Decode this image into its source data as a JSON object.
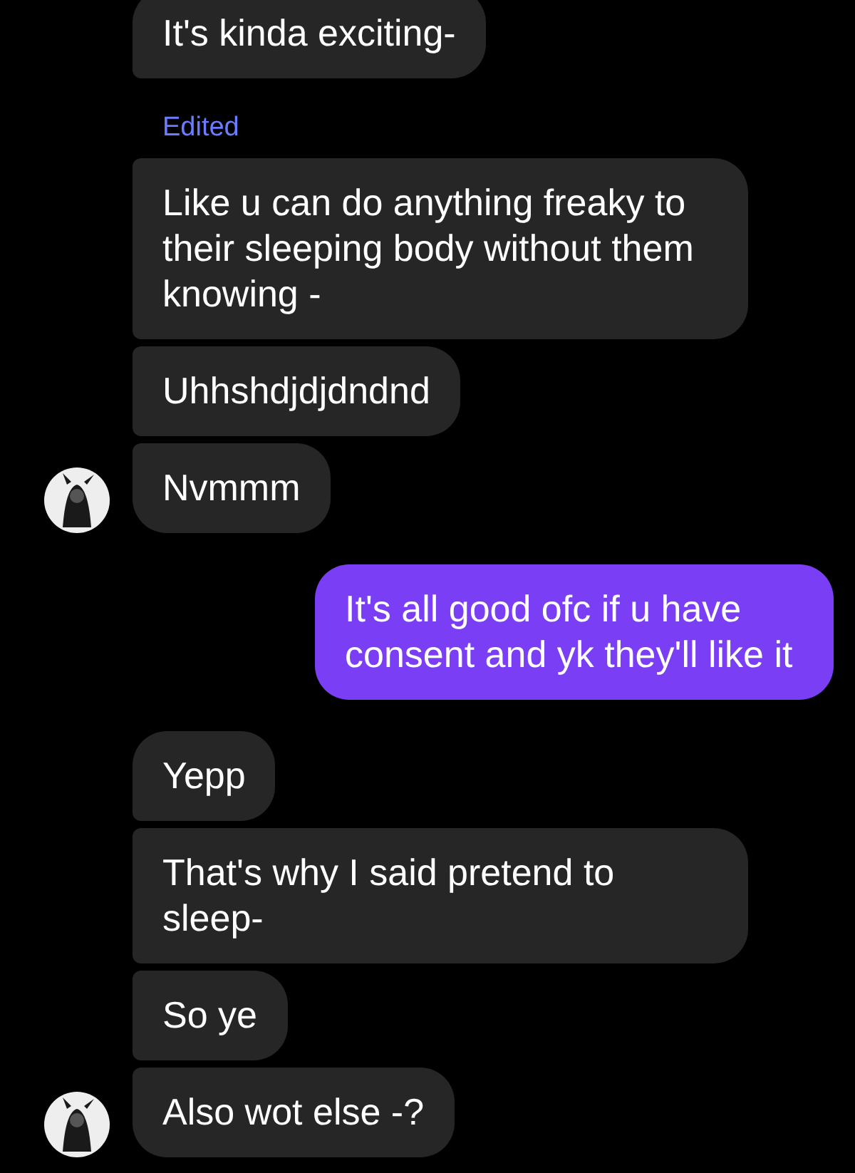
{
  "groups": [
    {
      "kind": "incoming",
      "messages": [
        {
          "text": "It's kinda exciting-"
        },
        {
          "text": "Like u can do anything freaky to their sleeping body without them knowing -",
          "edited": true
        },
        {
          "text": "Uhhshdjdjdndnd"
        },
        {
          "text": "Nvmmm"
        }
      ]
    },
    {
      "kind": "outgoing",
      "messages": [
        {
          "text": "It's all good ofc if u have consent and yk they'll like it"
        }
      ]
    },
    {
      "kind": "incoming",
      "messages": [
        {
          "text": "Yepp"
        },
        {
          "text": "That's why I said pretend to sleep-"
        },
        {
          "text": "So ye"
        },
        {
          "text": "Also wot else -?"
        }
      ]
    }
  ],
  "edited_label": "Edited"
}
